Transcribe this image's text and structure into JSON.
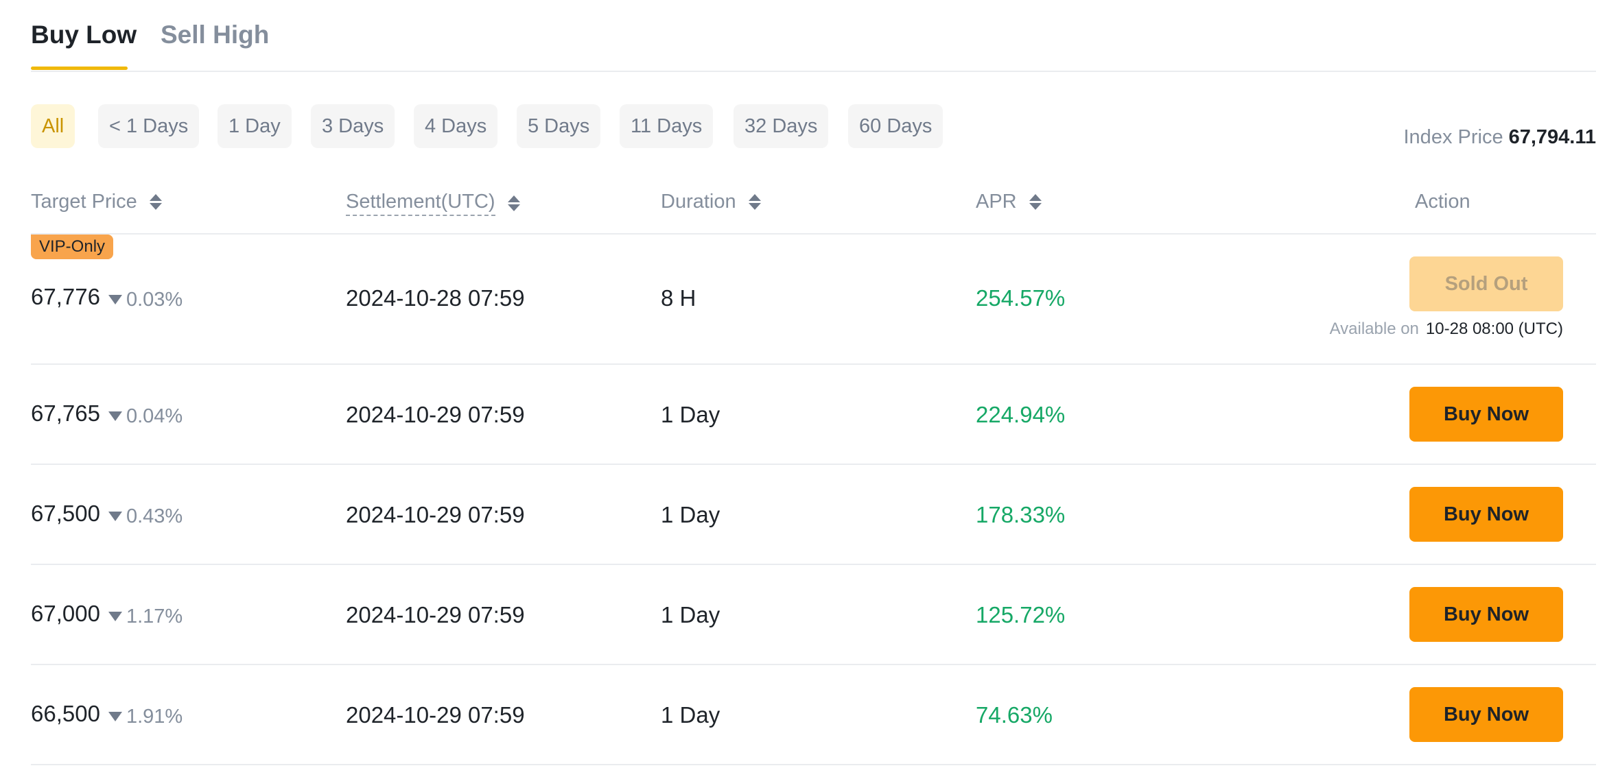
{
  "tabs": [
    {
      "label": "Buy Low",
      "active": true
    },
    {
      "label": "Sell High",
      "active": false
    }
  ],
  "filters": [
    "All",
    "< 1 Days",
    "1 Day",
    "3 Days",
    "4 Days",
    "5 Days",
    "11 Days",
    "32 Days",
    "60 Days"
  ],
  "selected_filter": "All",
  "index_price": {
    "label": "Index Price",
    "value": "67,794.11"
  },
  "columns": {
    "target_price": "Target Price",
    "settlement": "Settlement(UTC)",
    "duration": "Duration",
    "apr": "APR",
    "action": "Action"
  },
  "rows": [
    {
      "badge": "VIP-Only",
      "price": "67,776",
      "delta": "0.03%",
      "settlement": "2024-10-28 07:59",
      "duration": "8 H",
      "apr": "254.57%",
      "action": "Sold Out",
      "available_label": "Available on",
      "available_value": "10-28 08:00 (UTC)"
    },
    {
      "price": "67,765",
      "delta": "0.04%",
      "settlement": "2024-10-29 07:59",
      "duration": "1 Day",
      "apr": "224.94%",
      "action": "Buy Now"
    },
    {
      "price": "67,500",
      "delta": "0.43%",
      "settlement": "2024-10-29 07:59",
      "duration": "1 Day",
      "apr": "178.33%",
      "action": "Buy Now"
    },
    {
      "price": "67,000",
      "delta": "1.17%",
      "settlement": "2024-10-29 07:59",
      "duration": "1 Day",
      "apr": "125.72%",
      "action": "Buy Now"
    },
    {
      "price": "66,500",
      "delta": "1.91%",
      "settlement": "2024-10-29 07:59",
      "duration": "1 Day",
      "apr": "74.63%",
      "action": "Buy Now"
    }
  ],
  "colors": {
    "accent": "#f0b90b",
    "button": "#fc9806",
    "sold_out": "#fdd694",
    "apr_green": "#16a866",
    "vip_badge": "#f8a44c"
  }
}
